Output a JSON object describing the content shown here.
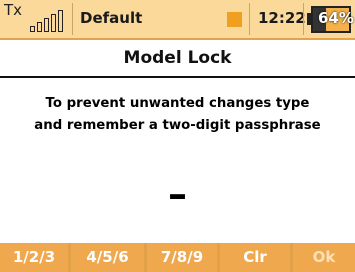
{
  "statusbar": {
    "tx_label": "Tx",
    "model_name": "Default",
    "time": "12:22:00",
    "battery_percent": "64%",
    "battery_level": 0.64
  },
  "screen": {
    "title": "Model Lock",
    "message_line1": "To prevent unwanted changes type",
    "message_line2": "and remember a two-digit passphrase",
    "passphrase": "–"
  },
  "buttons": {
    "b1": "1/2/3",
    "b2": "4/5/6",
    "b3": "7/8/9",
    "clr": "Clr",
    "ok": "Ok"
  },
  "colors": {
    "status_bg": "#fbd99b",
    "accent": "#f0a84e",
    "flag": "#f0a020"
  }
}
